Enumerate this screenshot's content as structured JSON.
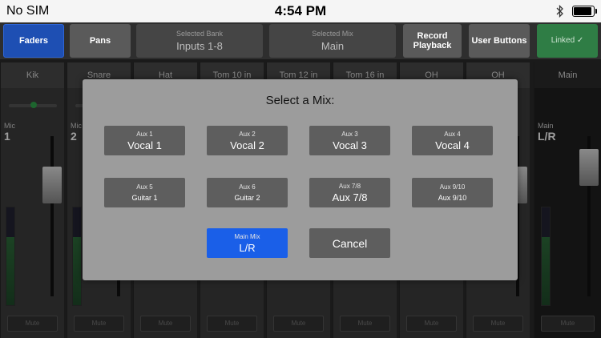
{
  "status_bar": {
    "carrier": "No SIM",
    "time": "4:54 PM"
  },
  "toolbar": {
    "faders_label": "Faders",
    "pans_label": "Pans",
    "selected_bank_title": "Selected Bank",
    "selected_bank_value": "Inputs 1-8",
    "selected_mix_title": "Selected Mix",
    "selected_mix_value": "Main",
    "record_label": "Record Playback",
    "user_buttons_label": "User Buttons",
    "linked_label": "Linked ✓"
  },
  "channels": [
    {
      "name": "Kik",
      "label": "Mic",
      "number": "1",
      "mute": "Mute"
    },
    {
      "name": "Snare",
      "label": "Mic",
      "number": "2",
      "mute": "Mute"
    },
    {
      "name": "Hat",
      "mute": "Mute"
    },
    {
      "name": "Tom 10 in",
      "mute": "Mute"
    },
    {
      "name": "Tom 12 in",
      "mute": "Mute"
    },
    {
      "name": "Tom 16 in",
      "mute": "Mute"
    },
    {
      "name": "OH",
      "mute": "Mute"
    },
    {
      "name": "OH",
      "mute": "Mute"
    }
  ],
  "main_channel": {
    "name": "Main",
    "label": "Main",
    "number": "L/R",
    "mute": "Mute"
  },
  "dialog": {
    "title": "Select a Mix:",
    "mixes": [
      {
        "label": "Aux 1",
        "name": "Vocal 1"
      },
      {
        "label": "Aux 2",
        "name": "Vocal 2"
      },
      {
        "label": "Aux 3",
        "name": "Vocal 3"
      },
      {
        "label": "Aux 4",
        "name": "Vocal 4"
      },
      {
        "label": "Aux 5",
        "name": "Guitar 1"
      },
      {
        "label": "Aux 6",
        "name": "Guitar 2"
      },
      {
        "label": "Aux 7/8",
        "name": "Aux 7/8"
      },
      {
        "label": "Aux 9/10",
        "name": "Aux 9/10"
      }
    ],
    "main_mix": {
      "label": "Main Mix",
      "name": "L/R"
    },
    "cancel_label": "Cancel"
  },
  "colors": {
    "selected_blue": "#1a5fe8",
    "linked_green": "#2f7d45",
    "faders_blue": "#1e4fb3"
  }
}
